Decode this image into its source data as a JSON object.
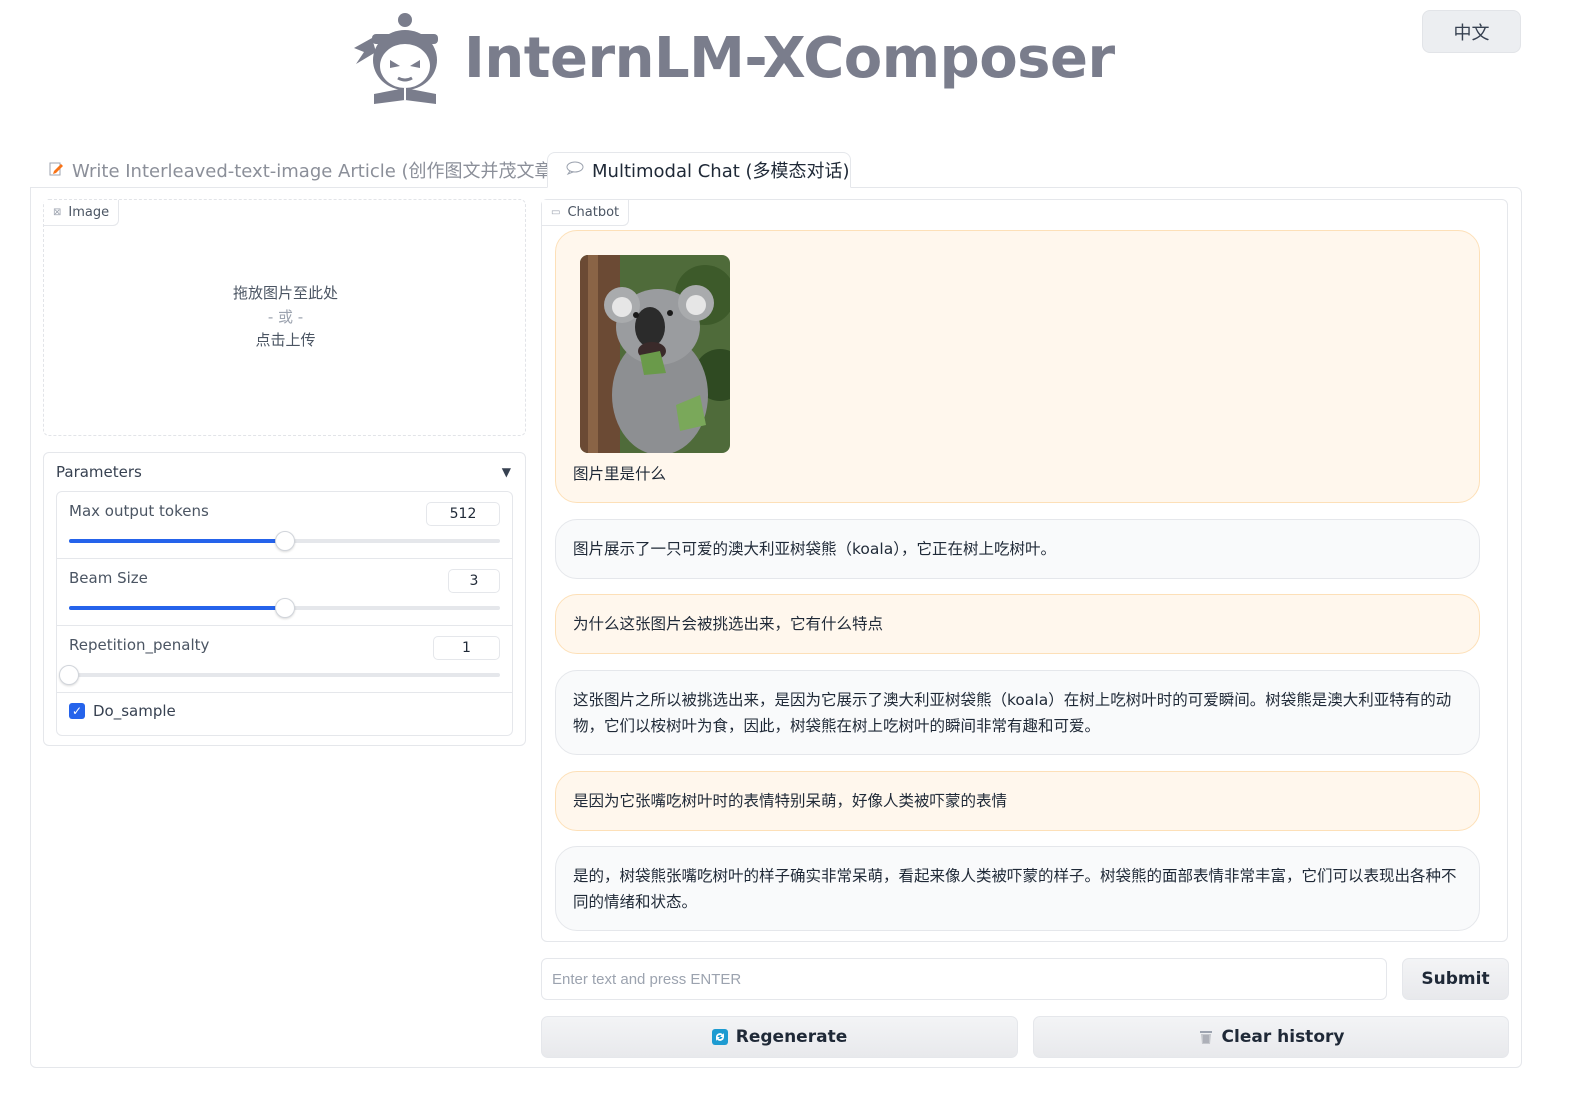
{
  "header": {
    "brand": "InternLM-XComposer",
    "lang_button": "中文"
  },
  "tabs": [
    {
      "label": "Write Interleaved-text-image Article (创作图文并茂文章)",
      "active": false,
      "icon": "edit-icon"
    },
    {
      "label": "Multimodal Chat (多模态对话)",
      "active": true,
      "icon": "speech-bubble-icon"
    }
  ],
  "image_panel": {
    "label": "Image",
    "drop_text": "拖放图片至此处",
    "or_text": "- 或 -",
    "click_text": "点击上传"
  },
  "parameters": {
    "title": "Parameters",
    "max_tokens": {
      "label": "Max output tokens",
      "value": "512",
      "fraction": 0.5
    },
    "beam_size": {
      "label": "Beam Size",
      "value": "3",
      "fraction": 0.5
    },
    "repetition": {
      "label": "Repetition_penalty",
      "value": "1",
      "fraction": 0.0
    },
    "do_sample": {
      "label": "Do_sample",
      "checked": true
    }
  },
  "chatbot": {
    "label": "Chatbot",
    "messages": [
      {
        "role": "user",
        "text": "图片里是什么",
        "has_image": true
      },
      {
        "role": "bot",
        "text": "图片展示了一只可爱的澳大利亚树袋熊（koala），它正在树上吃树叶。"
      },
      {
        "role": "user",
        "text": "为什么这张图片会被挑选出来，它有什么特点"
      },
      {
        "role": "bot",
        "text": "这张图片之所以被挑选出来，是因为它展示了澳大利亚树袋熊（koala）在树上吃树叶时的可爱瞬间。树袋熊是澳大利亚特有的动物，它们以桉树叶为食，因此，树袋熊在树上吃树叶的瞬间非常有趣和可爱。"
      },
      {
        "role": "user",
        "text": "是因为它张嘴吃树叶时的表情特别呆萌，好像人类被吓蒙的表情"
      },
      {
        "role": "bot",
        "text": "是的，树袋熊张嘴吃树叶的样子确实非常呆萌，看起来像人类被吓蒙的样子。树袋熊的面部表情非常丰富，它们可以表现出各种不同的情绪和状态。"
      }
    ]
  },
  "input": {
    "placeholder": "Enter text and press ENTER",
    "value": ""
  },
  "buttons": {
    "submit": "Submit",
    "regenerate": "Regenerate",
    "clear": "Clear history"
  },
  "colors": {
    "accent": "#2563eb",
    "user_bubble": "#fff7ed",
    "bot_bubble": "#f9fafb",
    "brand_gray": "#7a7d8c"
  }
}
